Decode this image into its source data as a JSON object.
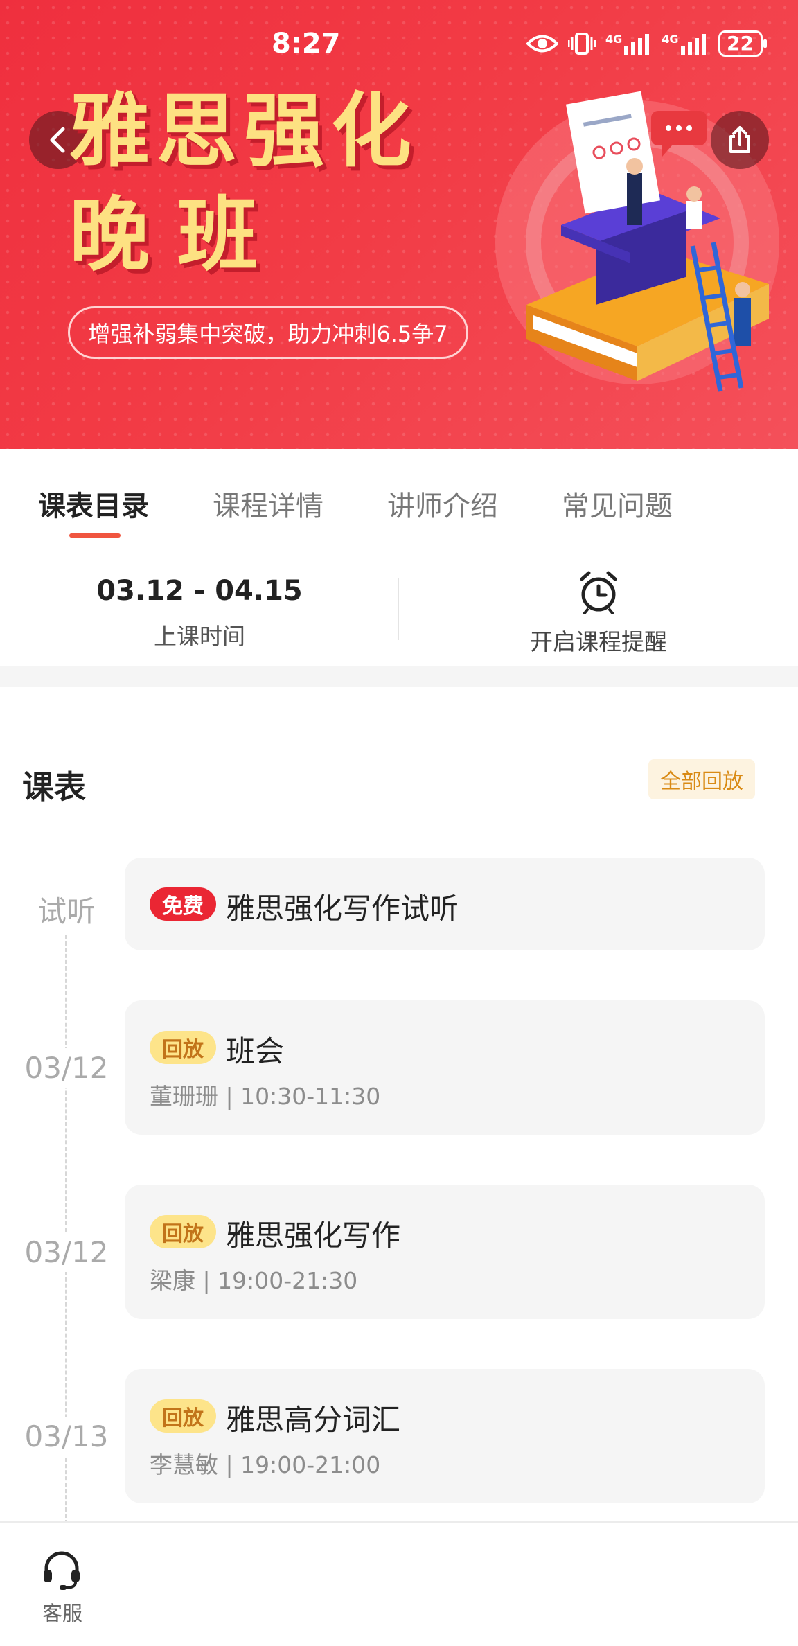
{
  "status_bar": {
    "time": "8:27",
    "network_labels": [
      "4G",
      "4G"
    ],
    "battery": "22",
    "icons": [
      "eye-icon",
      "vibrate-icon",
      "signal-4g-icon",
      "signal-4g-icon",
      "battery-icon"
    ]
  },
  "banner": {
    "title_line1": "雅思强化",
    "title_line2": "晚班",
    "tagline": "增强补弱集中突破，助力冲刺6.5争7",
    "colors": {
      "background": "#ef2f3e",
      "title": "#fde182"
    }
  },
  "tabs": [
    {
      "label": "课表目录",
      "active": true
    },
    {
      "label": "课程详情",
      "active": false
    },
    {
      "label": "讲师介绍",
      "active": false
    },
    {
      "label": "常见问题",
      "active": false
    }
  ],
  "course_info": {
    "date_range": "03.12 - 04.15",
    "date_label": "上课时间",
    "reminder_label": "开启课程提醒"
  },
  "schedule": {
    "title": "课表",
    "replay_all": "全部回放",
    "items": [
      {
        "date": "试听",
        "badge": "免费",
        "badge_type": "free",
        "title": "雅思强化写作试听",
        "subtitle": ""
      },
      {
        "date": "03/12",
        "badge": "回放",
        "badge_type": "replay",
        "title": "班会",
        "subtitle": "董珊珊 | 10:30-11:30"
      },
      {
        "date": "03/12",
        "badge": "回放",
        "badge_type": "replay",
        "title": "雅思强化写作",
        "subtitle": "梁康 | 19:00-21:30"
      },
      {
        "date": "03/13",
        "badge": "回放",
        "badge_type": "replay",
        "title": "雅思高分词汇",
        "subtitle": "李慧敏 | 19:00-21:00"
      }
    ]
  },
  "bottom_bar": {
    "customer_service": "客服"
  },
  "colors": {
    "accent": "#f0553f",
    "free_badge": "#ea2633",
    "replay_badge_bg": "#fde48a",
    "replay_badge_text": "#c2741a",
    "replay_all_text": "#d98a14"
  }
}
